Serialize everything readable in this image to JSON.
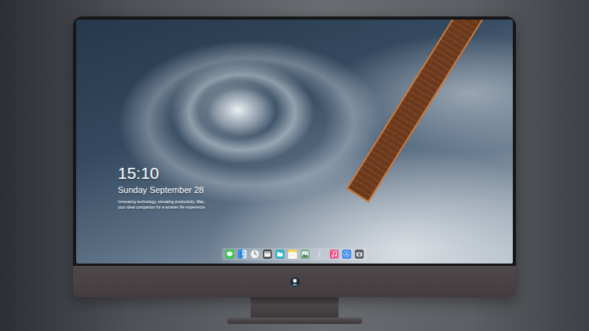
{
  "screen": {
    "time": "15:10",
    "date": "Sunday September 28",
    "tagline": [
      "Innovating technology, elevating productivity. Mac,",
      "your ideal companion for a smarter life experience"
    ]
  },
  "dock": {
    "apps": [
      {
        "kind": "messages",
        "color": "#3cc74e"
      },
      {
        "kind": "finder",
        "color": "#2f8fe8"
      },
      {
        "kind": "clock",
        "color": "#f2f2f2"
      },
      {
        "kind": "videos",
        "color": "#3a3a3c"
      },
      {
        "kind": "files",
        "color": "#2bb3c9"
      },
      {
        "kind": "notes",
        "color": "#f7d54a"
      },
      {
        "kind": "photos",
        "color": "#6aa86f"
      }
    ],
    "recent": [
      {
        "kind": "music",
        "color": "#f0568f"
      },
      {
        "kind": "appstore",
        "color": "#2d7ff0"
      },
      {
        "kind": "screenshot",
        "color": "#5a5a5e"
      }
    ]
  }
}
